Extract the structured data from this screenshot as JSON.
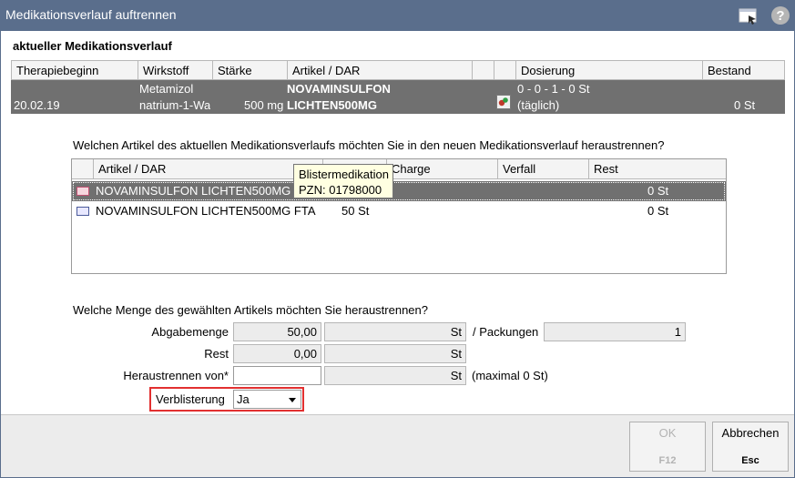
{
  "window": {
    "title": "Medikationsverlauf auftrennen",
    "window_icon": "window-icon",
    "help_icon": "help-icon",
    "help_glyph": "?"
  },
  "section_title": "aktueller Medikationsverlauf",
  "top_table": {
    "headers": [
      "Therapiebeginn",
      "Wirkstoff",
      "Stärke",
      "Artikel / DAR",
      "",
      "",
      "Dosierung",
      "Bestand"
    ],
    "row": {
      "therapiebeginn": "20.02.19",
      "wirkstoff_line1": "Metamizol",
      "wirkstoff_line2": "natrium-1-Wa",
      "staerke": "500 mg",
      "artikel_line1": "NOVAMINSULFON",
      "artikel_line2": "LICHTEN500MG",
      "dosierung_line1": "0 - 0 - 1 - 0 St",
      "dosierung_line2": "(täglich)",
      "bestand": "0 St"
    }
  },
  "question1": "Welchen Artikel des aktuellen Medikationsverlaufs möchten Sie in den neuen Medikationsverlauf heraustrennen?",
  "article_list": {
    "headers": [
      "",
      "Artikel / DAR",
      "",
      "Charge",
      "Verfall",
      "Rest"
    ],
    "rows": [
      {
        "artikel": "NOVAMINSULFON LICHTEN500MG FTA",
        "menge": "",
        "charge": "",
        "verfall": "",
        "rest": "0 St",
        "selected": true,
        "icon": "blister-icon"
      },
      {
        "artikel": "NOVAMINSULFON LICHTEN500MG FTA",
        "menge": "50 St",
        "charge": "",
        "verfall": "",
        "rest": "0 St",
        "selected": false,
        "icon": "package-icon"
      }
    ]
  },
  "tooltip": {
    "line1": "Blistermedikation",
    "line2": "PZN: 01798000"
  },
  "question2": "Welche Menge des gewählten Artikels möchten Sie heraustrennen?",
  "form": {
    "abgabemenge_label": "Abgabemenge",
    "abgabemenge_value": "50,00",
    "abgabemenge_unit": "St",
    "packungen_label": "/ Packungen",
    "packungen_value": "1",
    "rest_label": "Rest",
    "rest_value": "0,00",
    "rest_unit": "St",
    "heraustrennen_label": "Heraustrennen von*",
    "heraustrennen_value": "",
    "heraustrennen_unit": "St",
    "heraustrennen_hint": "(maximal 0 St)",
    "verblisterung_label": "Verblisterung",
    "verblisterung_value": "Ja"
  },
  "buttons": {
    "ok_label": "OK",
    "ok_key": "F12",
    "cancel_label": "Abbrechen",
    "cancel_key": "Esc"
  },
  "colors": {
    "titlebar": "#5a6e8c",
    "selected_row": "#707070",
    "highlight_border": "#e23030",
    "tooltip_bg": "#ffffe1"
  }
}
